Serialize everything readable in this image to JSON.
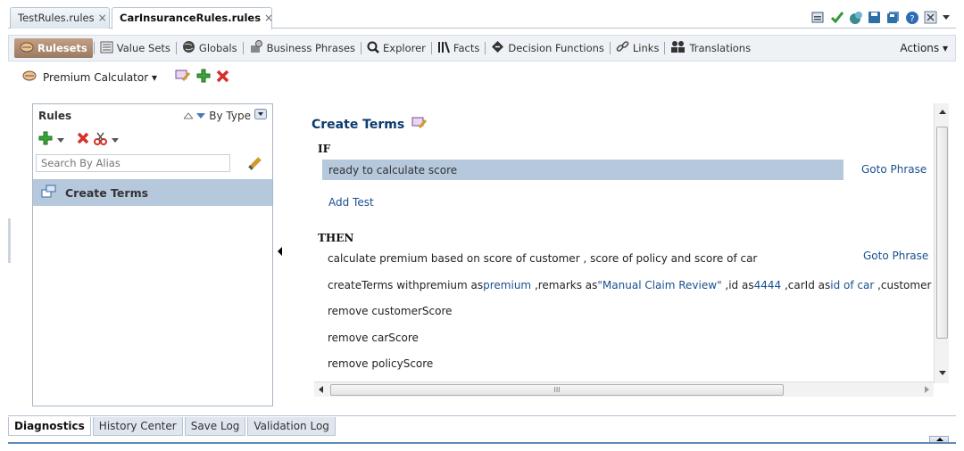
{
  "editor_tabs": [
    {
      "label": "TestRules.rules",
      "close": "×"
    },
    {
      "label": "CarInsuranceRules.rules",
      "close": "×"
    }
  ],
  "nav": {
    "items": [
      "Rulesets",
      "Value Sets",
      "Globals",
      "Business Phrases",
      "Explorer",
      "Facts",
      "Decision Functions",
      "Links",
      "Translations"
    ],
    "actions": "Actions ▾"
  },
  "ruleset": {
    "name": "Premium Calculator ▾"
  },
  "rules_panel": {
    "title": "Rules",
    "sort_label": "By Type",
    "search_placeholder": "Search By Alias",
    "selected_rule": "Create Terms"
  },
  "rule": {
    "title": "Create Terms",
    "if_label": "IF",
    "condition": "ready to calculate score",
    "goto_phrase": "Goto Phrase",
    "add_test": "Add Test",
    "then_label": "THEN",
    "action1": "calculate premium based on score of customer , score of policy and score of car",
    "action2": {
      "t1": "createTerms withpremium as",
      "v1": "premium",
      "t2": " ,remarks as",
      "v2": "\"Manual Claim Review\"",
      "t3": " ,id as",
      "v3": "4444",
      "t4": " ,carId as",
      "v4": "id of car",
      "t5": " ,customerId as",
      "v5": "custome"
    },
    "action3": "remove customerScore",
    "action4": "remove carScore",
    "action5": "remove policyScore"
  },
  "scroll": {
    "h_thumb_label": "III"
  },
  "bottom_tabs": [
    "Diagnostics",
    "History Center",
    "Save Log",
    "Validation Log"
  ]
}
